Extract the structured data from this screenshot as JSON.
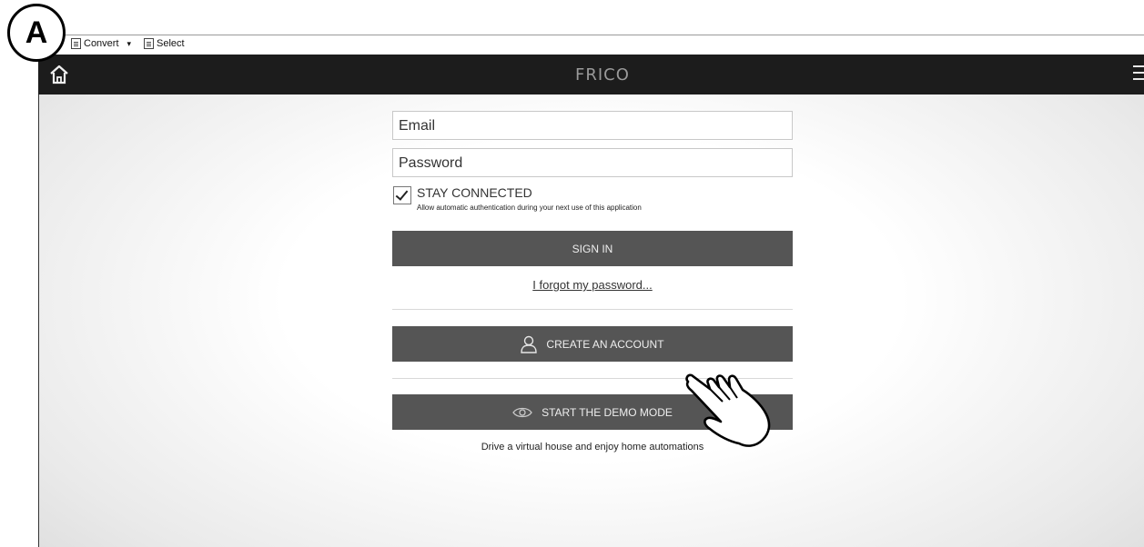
{
  "callout": {
    "label": "A"
  },
  "toolbar": {
    "convert_label": "Convert",
    "select_label": "Select",
    "convert_caret": "▾"
  },
  "header": {
    "logo_text": "FRICO",
    "home_icon": "home-icon",
    "menu_icon": "hamburger-menu-icon",
    "background": "#1c1c1c"
  },
  "login": {
    "email_placeholder": "Email",
    "password_placeholder": "Password",
    "stay_connected_label": "STAY CONNECTED",
    "stay_connected_checked": true,
    "stay_connected_note": "Allow automatic authentication during your next use of this application",
    "sign_in_label": "SIGN IN",
    "forgot_label": "I forgot my password..."
  },
  "account": {
    "create_label": "CREATE AN ACCOUNT",
    "create_icon": "user-icon"
  },
  "demo": {
    "demo_label": "START THE DEMO MODE",
    "demo_icon": "eye-icon",
    "demo_description": "Drive a virtual house and enjoy home automations"
  },
  "colors": {
    "button": "#555555",
    "button_text": "#eeeeee"
  }
}
